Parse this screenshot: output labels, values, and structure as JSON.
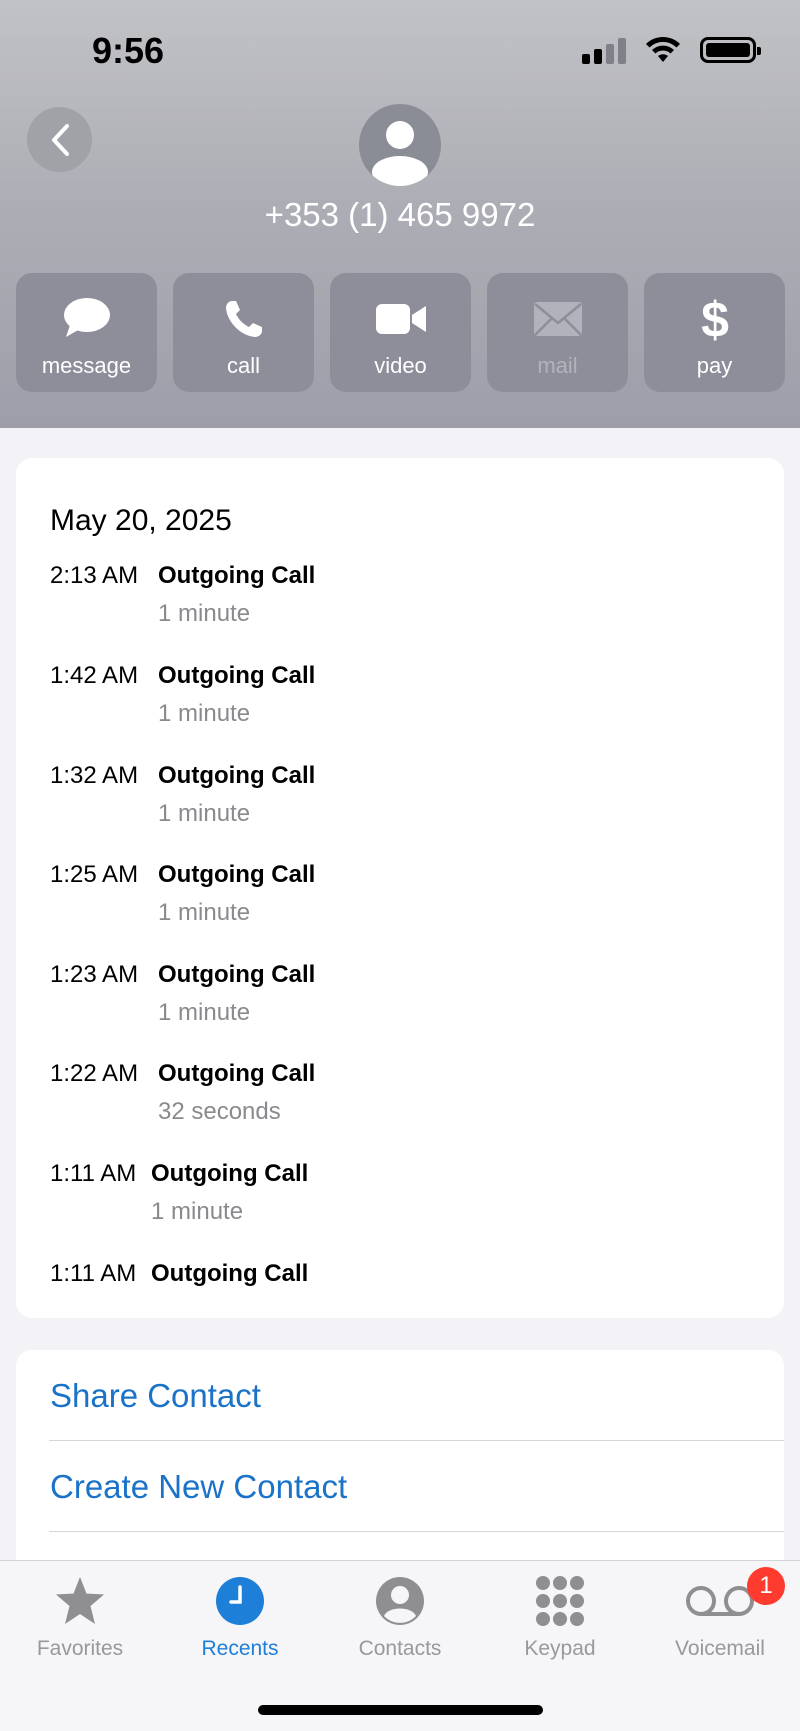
{
  "status": {
    "time": "9:56"
  },
  "contact": {
    "phone": "+353 (1) 465 9972"
  },
  "actions": [
    {
      "label": "message",
      "icon": "message-icon",
      "enabled": true
    },
    {
      "label": "call",
      "icon": "phone-icon",
      "enabled": true
    },
    {
      "label": "video",
      "icon": "video-icon",
      "enabled": true
    },
    {
      "label": "mail",
      "icon": "mail-icon",
      "enabled": false
    },
    {
      "label": "pay",
      "icon": "dollar-icon",
      "enabled": true
    }
  ],
  "calls": {
    "date": "May 20, 2025",
    "items": [
      {
        "time": "2:13 AM",
        "type": "Outgoing Call",
        "duration": "1 minute"
      },
      {
        "time": "1:42 AM",
        "type": "Outgoing Call",
        "duration": "1 minute"
      },
      {
        "time": "1:32 AM",
        "type": "Outgoing Call",
        "duration": "1 minute"
      },
      {
        "time": "1:25 AM",
        "type": "Outgoing Call",
        "duration": "1 minute"
      },
      {
        "time": "1:23 AM",
        "type": "Outgoing Call",
        "duration": "1 minute"
      },
      {
        "time": "1:22 AM",
        "type": "Outgoing Call",
        "duration": "32 seconds"
      },
      {
        "time": "1:11 AM",
        "type": "Outgoing Call",
        "duration": "1 minute"
      },
      {
        "time": "1:11 AM",
        "type": "Outgoing Call",
        "duration": ""
      }
    ]
  },
  "links": {
    "share": "Share Contact",
    "create": "Create New Contact"
  },
  "tabs": [
    {
      "label": "Favorites",
      "icon": "star-icon"
    },
    {
      "label": "Recents",
      "icon": "clock-icon",
      "active": true
    },
    {
      "label": "Contacts",
      "icon": "person-circle-icon"
    },
    {
      "label": "Keypad",
      "icon": "keypad-icon"
    },
    {
      "label": "Voicemail",
      "icon": "voicemail-icon"
    }
  ],
  "voicemail_badge": "1",
  "colors": {
    "accent": "#1e7fd8",
    "link": "#1a73c8",
    "badge": "#ff3b30"
  }
}
